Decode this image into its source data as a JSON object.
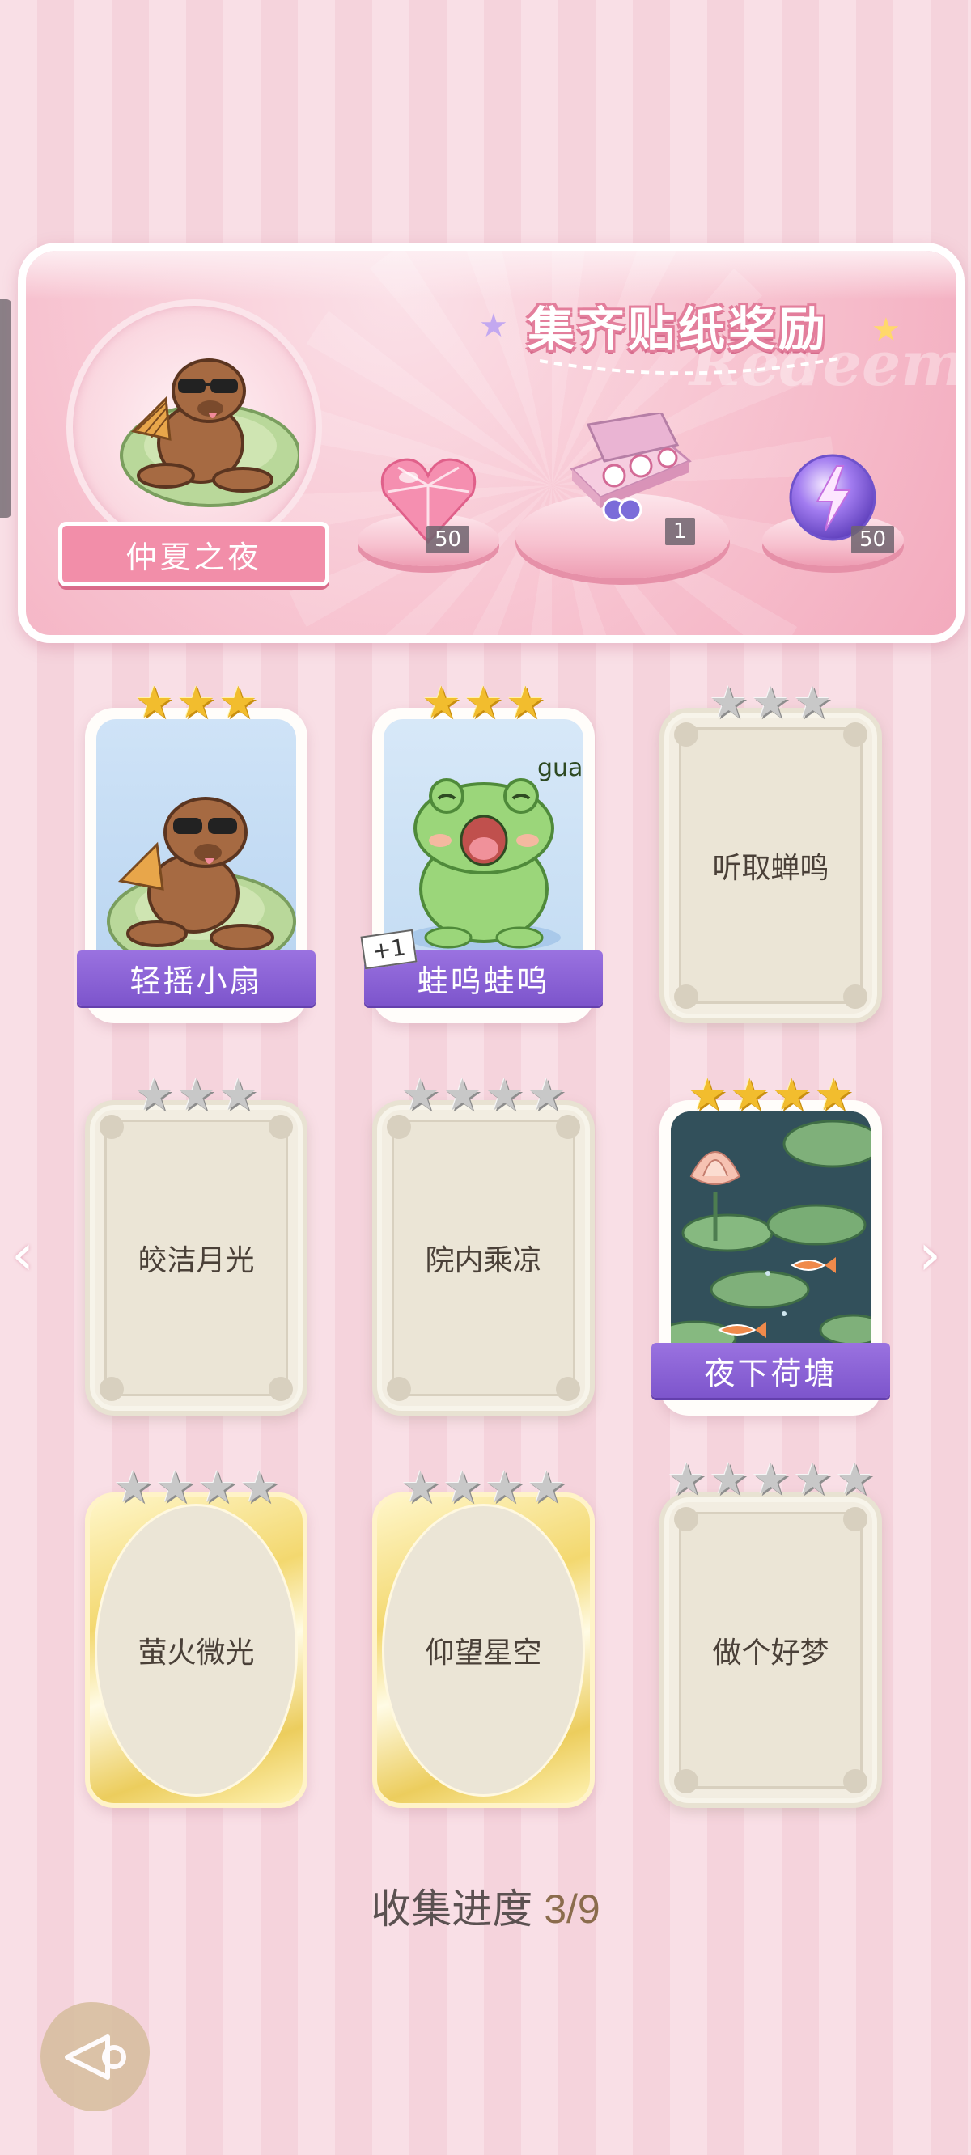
{
  "banner": {
    "title": "集齐贴纸奖励",
    "watermark": "Redeem",
    "theme_name": "仲夏之夜",
    "rewards": [
      {
        "icon": "pink-heart-gem-icon",
        "count": "50"
      },
      {
        "icon": "gift-box-icon",
        "count": "1"
      },
      {
        "icon": "purple-energy-orb-icon",
        "count": "50"
      }
    ]
  },
  "cards": [
    {
      "name": "轻摇小扇",
      "stars": 3,
      "collected": true,
      "art": "capybara-fan"
    },
    {
      "name": "蛙呜蛙呜",
      "stars": 3,
      "collected": true,
      "art": "frog-gua",
      "badge": "+1",
      "art_text": "gua"
    },
    {
      "name": "听取蝉鸣",
      "stars": 3,
      "collected": false
    },
    {
      "name": "皎洁月光",
      "stars": 3,
      "collected": false
    },
    {
      "name": "院内乘凉",
      "stars": 4,
      "collected": false
    },
    {
      "name": "夜下荷塘",
      "stars": 4,
      "collected": true,
      "art": "lotus-pond"
    },
    {
      "name": "萤火微光",
      "stars": 4,
      "collected": false,
      "style": "gold"
    },
    {
      "name": "仰望星空",
      "stars": 4,
      "collected": false,
      "style": "gold"
    },
    {
      "name": "做个好梦",
      "stars": 5,
      "collected": false
    }
  ],
  "progress": {
    "label": "收集进度",
    "value": "3/9"
  },
  "colors": {
    "ribbon": "#8b63d6",
    "banner_pink": "#f6b3c5",
    "gold_star": "#f2bd2e"
  }
}
